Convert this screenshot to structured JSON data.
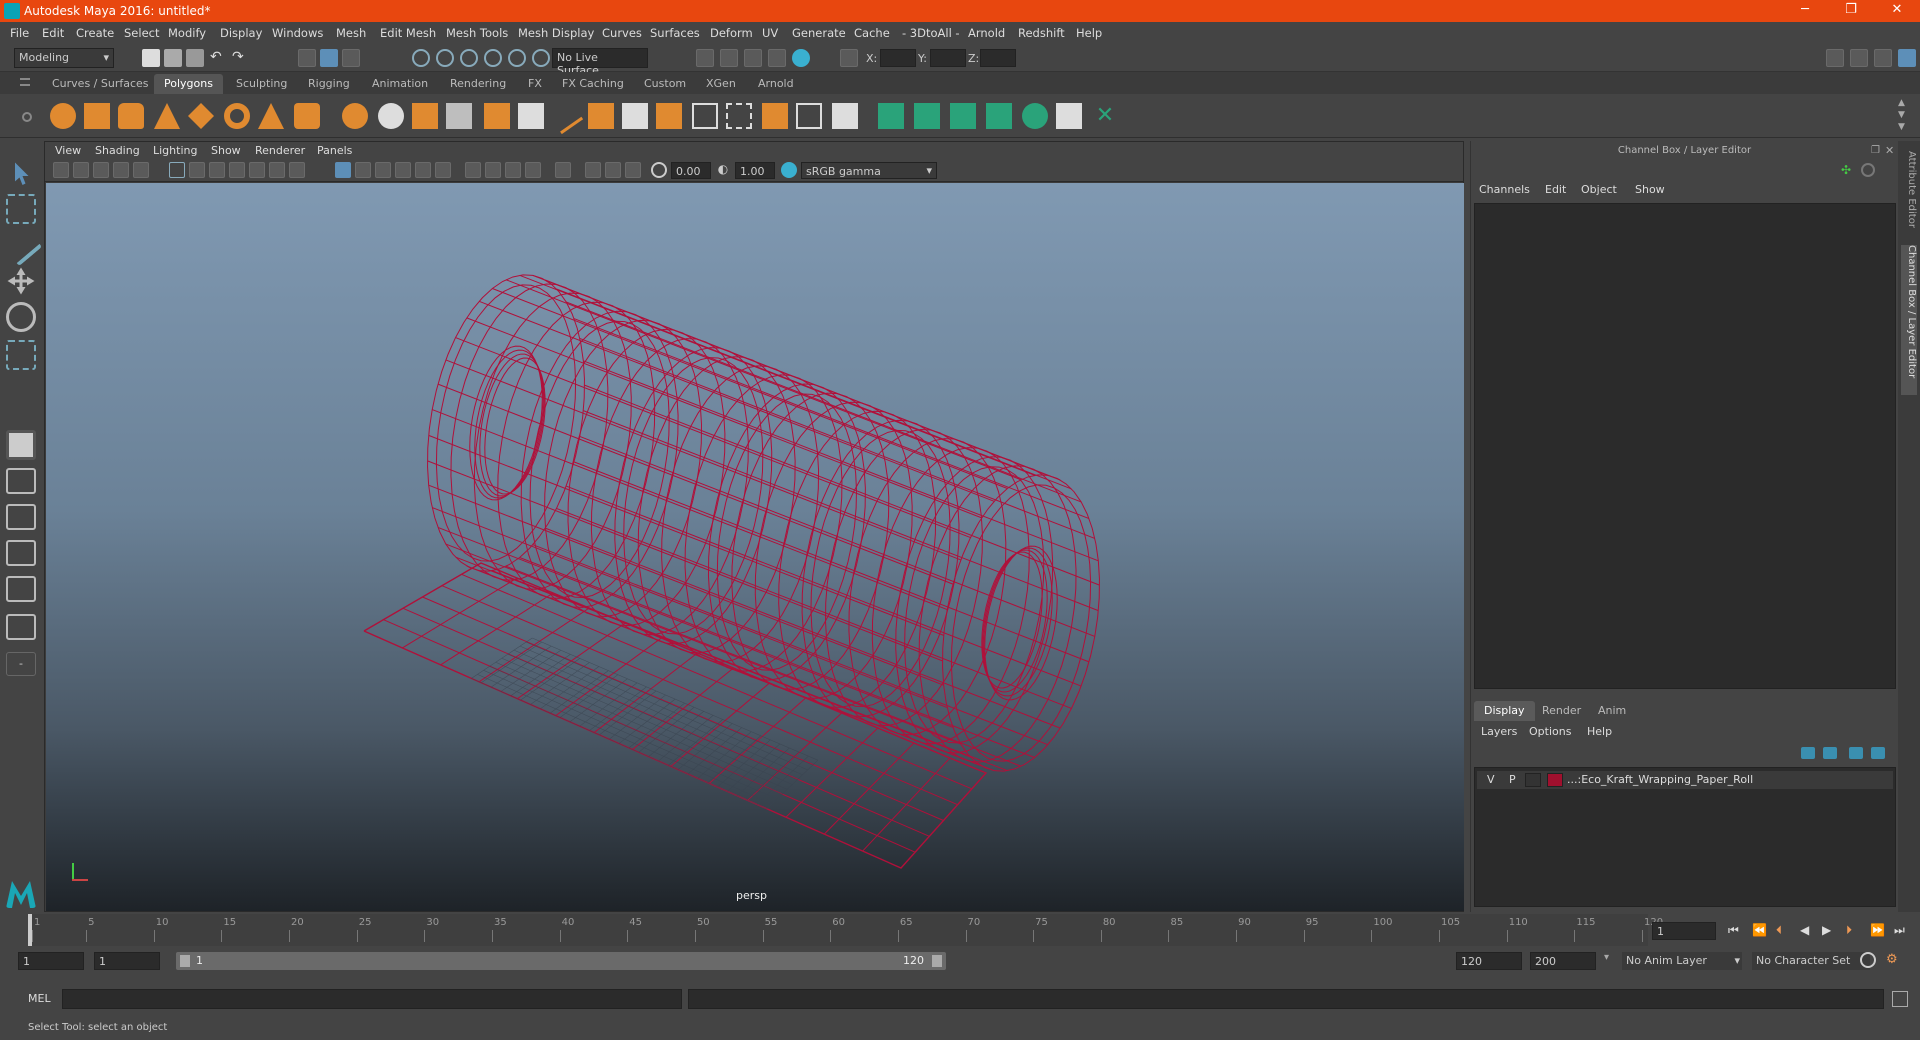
{
  "app": {
    "title": "Autodesk Maya 2016: untitled*"
  },
  "window_buttons": {
    "minimize": "─",
    "restore": "❐",
    "close": "✕"
  },
  "menubar": [
    "File",
    "Edit",
    "Create",
    "Select",
    "Modify",
    "Display",
    "Windows",
    "Mesh",
    "Edit Mesh",
    "Mesh Tools",
    "Mesh Display",
    "Curves",
    "Surfaces",
    "Deform",
    "UV",
    "Generate",
    "Cache",
    "- 3DtoAll -",
    "Arnold",
    "Redshift",
    "Help"
  ],
  "statusline": {
    "mode": "Modeling",
    "live_surface": "No Live Surface",
    "x_label": "X:",
    "y_label": "Y:",
    "z_label": "Z:"
  },
  "shelf_tabs": [
    "Curves / Surfaces",
    "Polygons",
    "Sculpting",
    "Rigging",
    "Animation",
    "Rendering",
    "FX",
    "FX Caching",
    "Custom",
    "XGen",
    "Arnold"
  ],
  "active_shelf_tab": "Polygons",
  "viewport": {
    "menu": [
      "View",
      "Shading",
      "Lighting",
      "Show",
      "Renderer",
      "Panels"
    ],
    "exposure": "0.00",
    "gamma": "1.00",
    "color_space": "sRGB gamma",
    "camera_label": "persp",
    "wire_color": "#b0103a"
  },
  "right_panel": {
    "title": "Channel Box / Layer Editor",
    "channel_menu": [
      "Channels",
      "Edit",
      "Object",
      "Show"
    ],
    "layer_tabs": [
      "Display",
      "Render",
      "Anim"
    ],
    "active_layer_tab": "Display",
    "layer_menu": [
      "Layers",
      "Options",
      "Help"
    ],
    "layer": {
      "v": "V",
      "p": "P",
      "name": "...:Eco_Kraft_Wrapping_Paper_Roll",
      "color": "#a0102e"
    }
  },
  "side_tabs": [
    "Attribute Editor",
    "Channel Box / Layer Editor"
  ],
  "timeline": {
    "ticks": [
      "1",
      "5",
      "10",
      "15",
      "20",
      "25",
      "30",
      "35",
      "40",
      "45",
      "50",
      "55",
      "60",
      "65",
      "70",
      "75",
      "80",
      "85",
      "90",
      "95",
      "100",
      "105",
      "110",
      "115",
      "120"
    ],
    "current_frame": "1"
  },
  "range": {
    "start": "1",
    "playback_start": "1",
    "slider_start": "1",
    "slider_end": "120",
    "playback_end": "120",
    "end": "200",
    "anim_layer": "No Anim Layer",
    "character_set": "No Character Set"
  },
  "cmdline": {
    "label": "MEL"
  },
  "help_line": "Select Tool: select an object"
}
